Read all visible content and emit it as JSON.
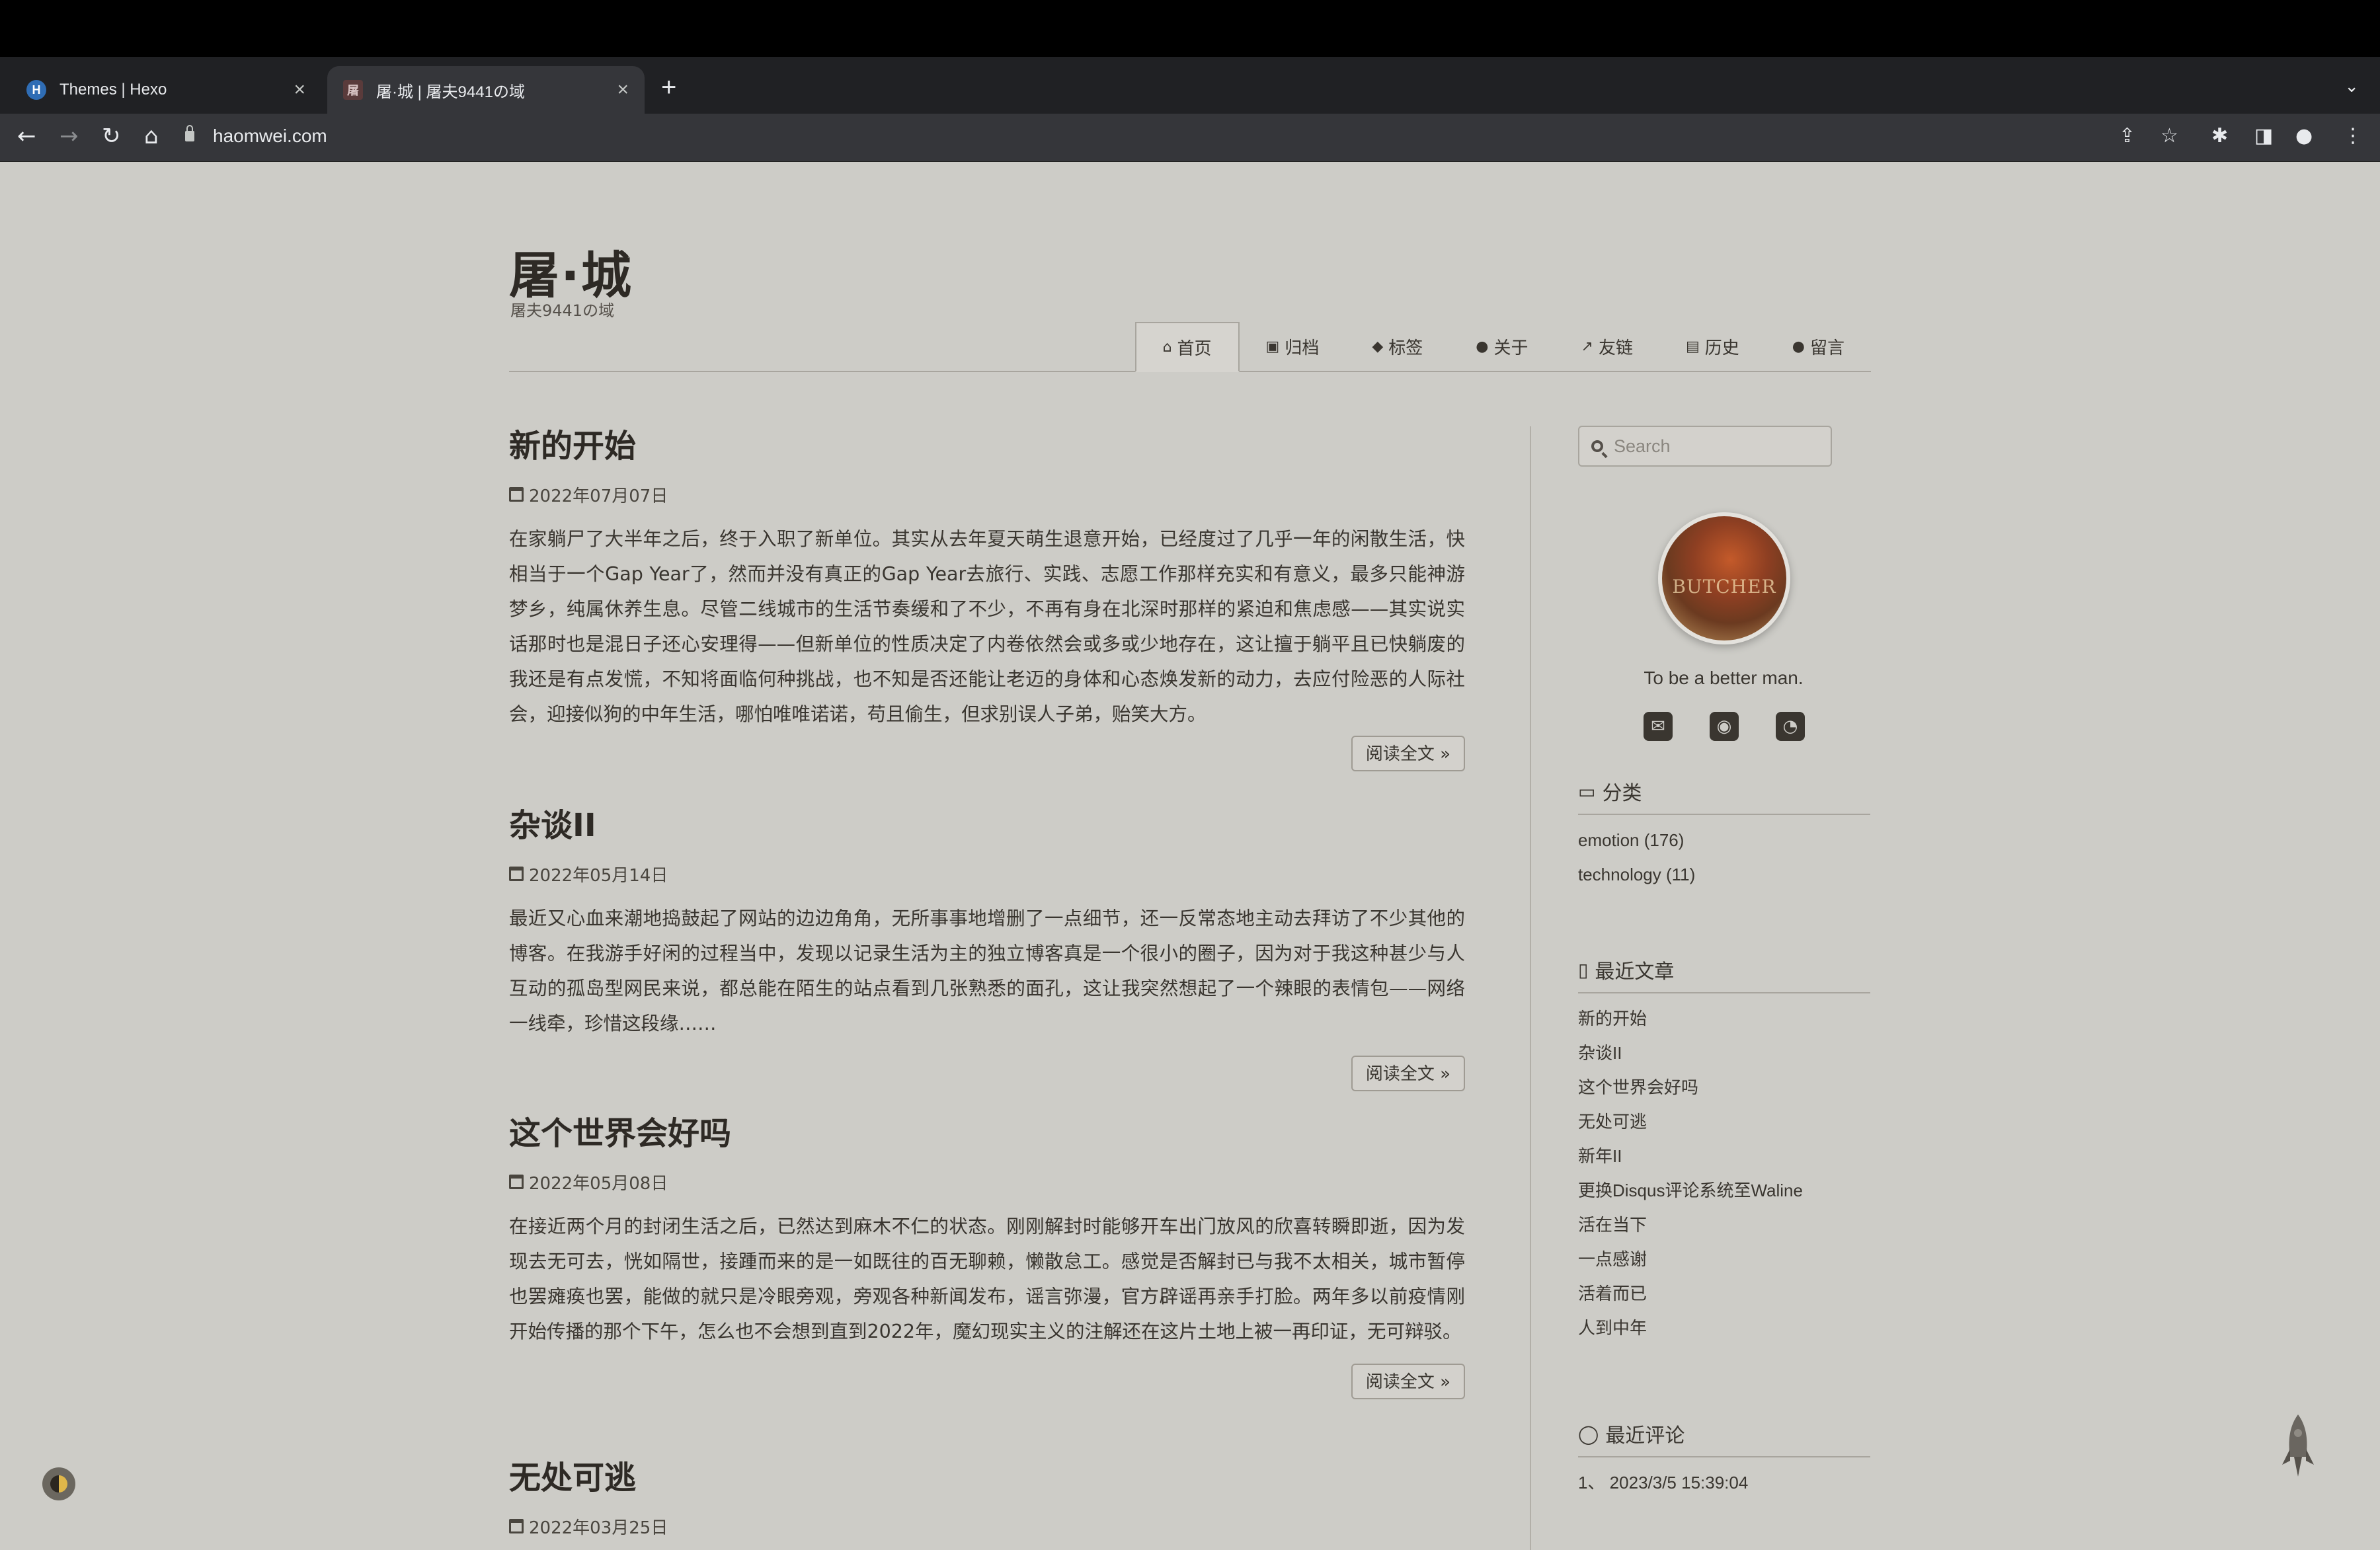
{
  "browser": {
    "tabs": [
      {
        "title": "Themes | Hexo",
        "favicon": "H",
        "active": false
      },
      {
        "title": "屠·城 | 屠夫9441の域",
        "favicon": "屠",
        "active": true
      }
    ],
    "new_tab": "+",
    "url": "haomwei.com"
  },
  "site": {
    "title": "屠·城",
    "subtitle": "屠夫9441の域"
  },
  "menu": [
    {
      "icon": "home-icon",
      "glyph": "⌂",
      "label": "首页",
      "active": true
    },
    {
      "icon": "archive-icon",
      "glyph": "▣",
      "label": "归档"
    },
    {
      "icon": "tag-icon",
      "glyph": "◆",
      "label": "标签"
    },
    {
      "icon": "user-icon",
      "glyph": "●",
      "label": "关于"
    },
    {
      "icon": "external-link-icon",
      "glyph": "↗",
      "label": "友链"
    },
    {
      "icon": "book-icon",
      "glyph": "▤",
      "label": "历史"
    },
    {
      "icon": "comments-icon",
      "glyph": "●",
      "label": "留言"
    }
  ],
  "posts": [
    {
      "title": "新的开始",
      "date": "2022年07月07日",
      "excerpt": "在家躺尸了大半年之后，终于入职了新单位。其实从去年夏天萌生退意开始，已经度过了几乎一年的闲散生活，快相当于一个Gap Year了，然而并没有真正的Gap Year去旅行、实践、志愿工作那样充实和有意义，最多只能神游梦乡，纯属休养生息。尽管二线城市的生活节奏缓和了不少，不再有身在北深时那样的紧迫和焦虑感——其实说实话那时也是混日子还心安理得——但新单位的性质决定了内卷依然会或多或少地存在，这让擅于躺平且已快躺废的我还是有点发慌，不知将面临何种挑战，也不知是否还能让老迈的身体和心态焕发新的动力，去应付险恶的人际社会，迎接似狗的中年生活，哪怕唯唯诺诺，苟且偷生，但求别误人子弟，贻笑大方。",
      "read_more": "阅读全文 »"
    },
    {
      "title": "杂谈II",
      "date": "2022年05月14日",
      "excerpt": "最近又心血来潮地捣鼓起了网站的边边角角，无所事事地增删了一点细节，还一反常态地主动去拜访了不少其他的博客。在我游手好闲的过程当中，发现以记录生活为主的独立博客真是一个很小的圈子，因为对于我这种甚少与人互动的孤岛型网民来说，都总能在陌生的站点看到几张熟悉的面孔，这让我突然想起了一个辣眼的表情包——网络一线牵，珍惜这段缘……",
      "read_more": "阅读全文 »"
    },
    {
      "title": "这个世界会好吗",
      "date": "2022年05月08日",
      "excerpt": "在接近两个月的封闭生活之后，已然达到麻木不仁的状态。刚刚解封时能够开车出门放风的欣喜转瞬即逝，因为发现去无可去，恍如隔世，接踵而来的是一如既往的百无聊赖，懒散怠工。感觉是否解封已与我不太相关，城市暂停也罢瘫痪也罢，能做的就只是冷眼旁观，旁观各种新闻发布，谣言弥漫，官方辟谣再亲手打脸。两年多以前疫情刚开始传播的那个下午，怎么也不会想到直到2022年，魔幻现实主义的注解还在这片土地上被一再印证，无可辩驳。",
      "read_more": "阅读全文 »"
    },
    {
      "title": "无处可逃",
      "date": "2022年03月25日"
    }
  ],
  "sidebar": {
    "search_placeholder": "Search",
    "avatar_text": "BUTCHER",
    "motto": "To be a better man.",
    "socials": [
      "envelope-icon",
      "github-icon",
      "rss-icon"
    ],
    "categories_title": "分类",
    "categories": [
      "emotion (176)",
      "technology (11)"
    ],
    "recent_posts_title": "最近文章",
    "recent_posts": [
      "新的开始",
      "杂谈II",
      "这个世界会好吗",
      "无处可逃",
      "新年II",
      "更换Disqus评论系统至Waline",
      "活在当下",
      "一点感谢",
      "活着而已",
      "人到中年"
    ],
    "recent_comments_title": "最近评论",
    "recent_comments": [
      "1、 2023/3/5 15:39:04"
    ]
  },
  "colors": {
    "page_bg": "#cdccc7",
    "text": "#3a3630",
    "chrome_bg": "#35363a"
  }
}
